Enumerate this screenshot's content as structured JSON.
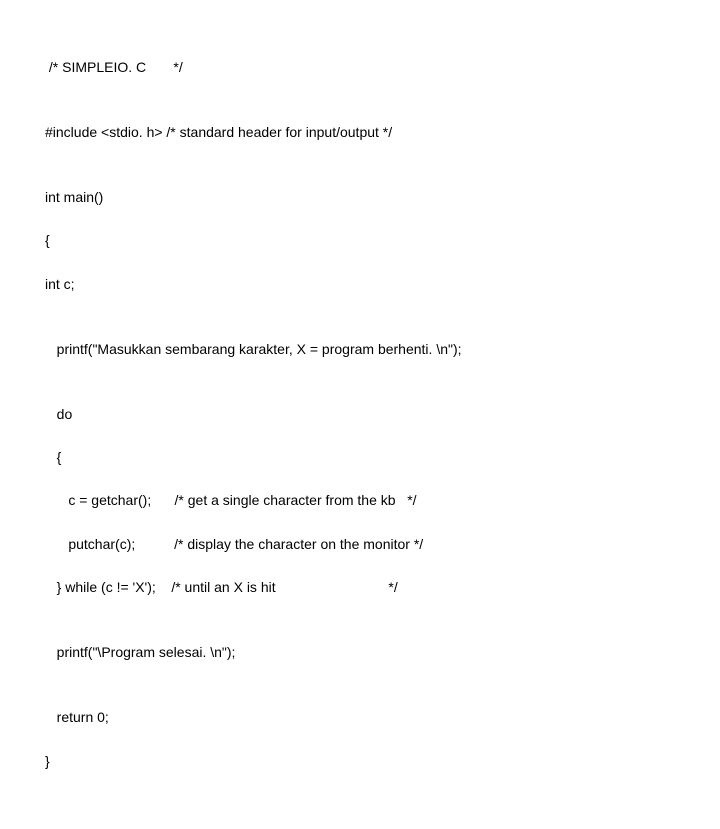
{
  "code": {
    "l1": " /* SIMPLEIO. C       */",
    "l2": "",
    "l3": "#include <stdio. h> /* standard header for input/output */",
    "l4": "",
    "l5": "int main()",
    "l6": "{",
    "l7": "int c;",
    "l8": "",
    "l9": "   printf(\"Masukkan sembarang karakter, X = program berhenti. \\n\");",
    "l10": "",
    "l11": "   do",
    "l12": "   {",
    "l13": "      c = getchar();      /* get a single character from the kb   */",
    "l14": "      putchar(c);          /* display the character on the monitor */",
    "l15": "   } while (c != 'X');    /* until an X is hit                             */",
    "l16": "",
    "l17": "   printf(\"\\Program selesai. \\n\");",
    "l18": "",
    "l19": "   return 0;",
    "l20": "}"
  }
}
